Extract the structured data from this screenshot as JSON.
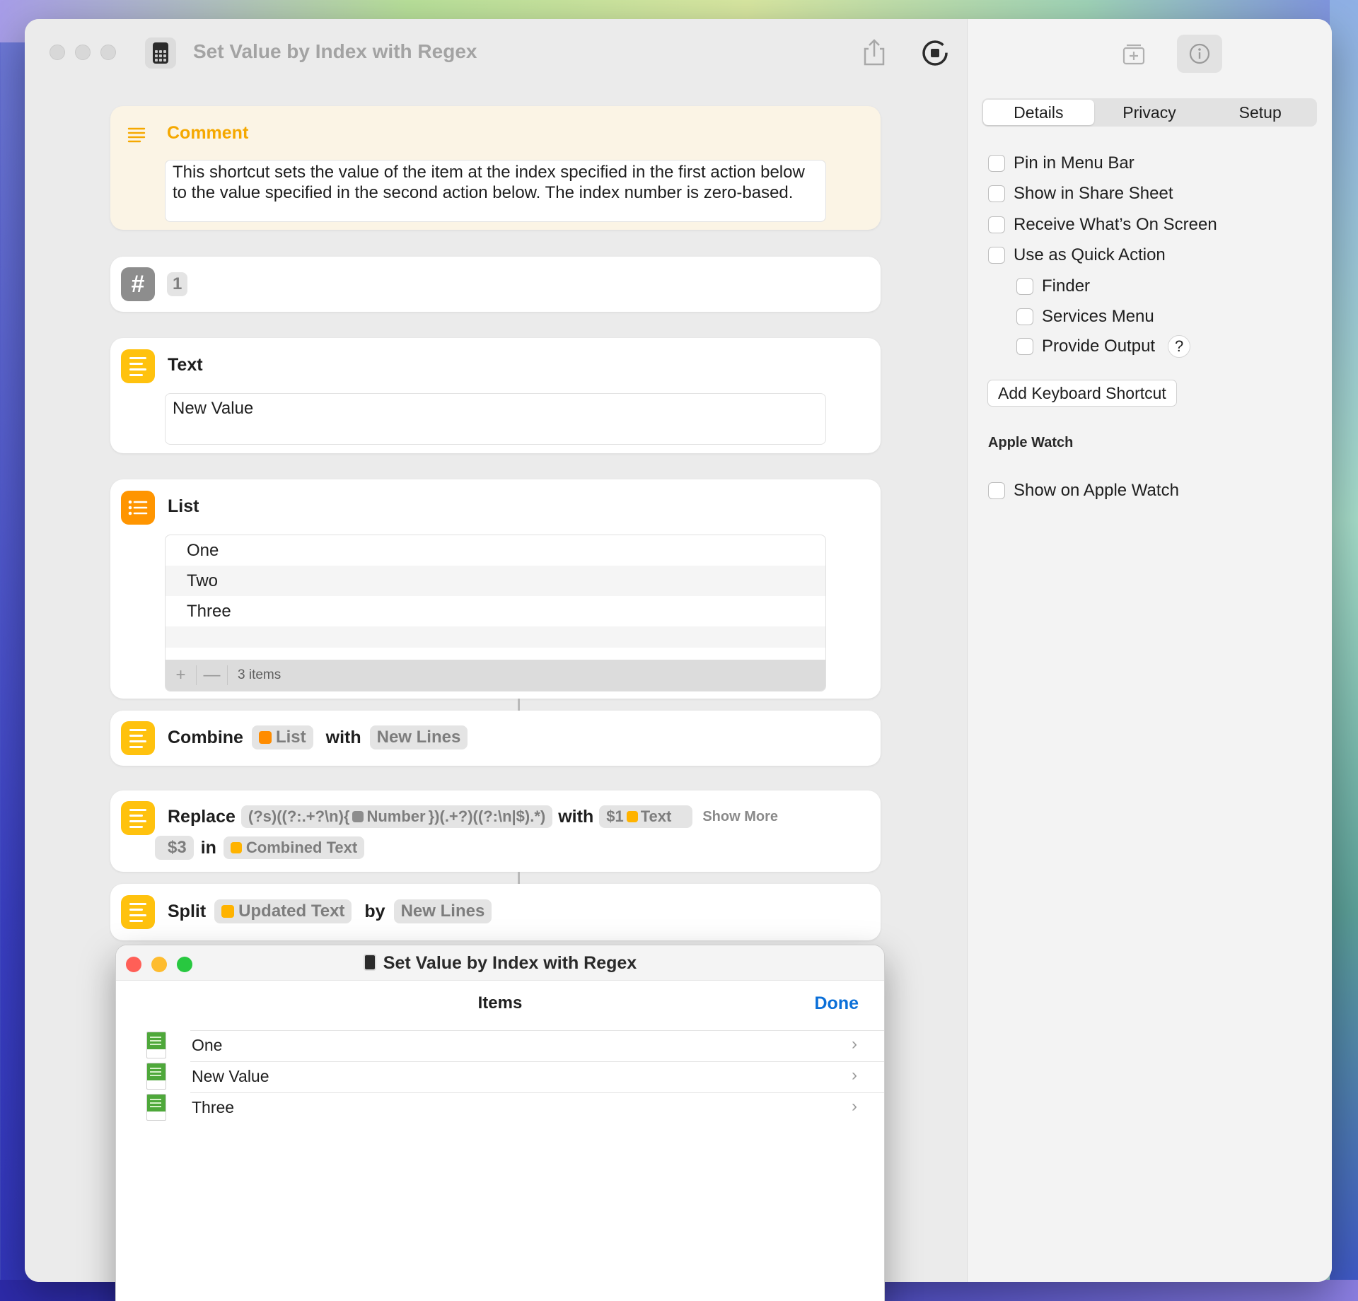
{
  "window": {
    "title": "Set Value by Index with Regex"
  },
  "actions": {
    "comment": {
      "title": "Comment",
      "text": "This shortcut sets the value of the item at the index specified in the first action below to the value specified in the second action below. The index number is zero-based."
    },
    "number": {
      "value": "1"
    },
    "text_action": {
      "title": "Text",
      "value": "New Value"
    },
    "list_action": {
      "title": "List",
      "items": [
        "One",
        "Two",
        "Three"
      ],
      "count_label": "3 items",
      "add_label": "+",
      "remove_label": "—"
    },
    "combine": {
      "verb": "Combine",
      "input": "List",
      "with_word": "with",
      "separator": "New Lines"
    },
    "replace": {
      "verb": "Replace",
      "pattern_start": "(?s)((?:.+?\\n){",
      "pattern_var": "Number",
      "pattern_end": "})(.+?)((?:\\n|$).*)",
      "with_word": "with",
      "replacement_prefix": "$1",
      "replacement_var": "Text",
      "show_more": "Show More",
      "replacement_suffix": "$3",
      "in_word": "in",
      "target": "Combined Text"
    },
    "split": {
      "verb": "Split",
      "input": "Updated Text",
      "by_word": "by",
      "separator": "New Lines"
    }
  },
  "sidebar": {
    "tabs": [
      "Details",
      "Privacy",
      "Setup"
    ],
    "active_tab": "Details",
    "options": {
      "pin_menu_bar": "Pin in Menu Bar",
      "share_sheet": "Show in Share Sheet",
      "receive_screen": "Receive What’s On Screen",
      "quick_action": "Use as Quick Action",
      "finder": "Finder",
      "services_menu": "Services Menu",
      "provide_output": "Provide Output",
      "help": "?"
    },
    "keyboard_button": "Add Keyboard Shortcut",
    "watch_section": "Apple Watch",
    "watch_option": "Show on Apple Watch"
  },
  "overlay": {
    "title": "Set Value by Index with Regex",
    "heading": "Items",
    "done": "Done",
    "items": [
      "One",
      "New Value",
      "Three"
    ]
  },
  "colors": {
    "yellow_action": "#ffc20e",
    "orange_action": "#ff9500",
    "comment_title": "#f5a800",
    "done_blue": "#0a6fd8",
    "close_red": "#ff5f57",
    "minimize_yellow": "#febc2e",
    "zoom_green": "#28c840"
  },
  "icons": [
    "calculator-icon",
    "share-icon",
    "run-icon",
    "add-to-dock-icon",
    "info-icon",
    "comment-icon",
    "hash-icon",
    "text-lines-icon",
    "list-icon",
    "chevron-right-icon",
    "text-file-icon"
  ]
}
